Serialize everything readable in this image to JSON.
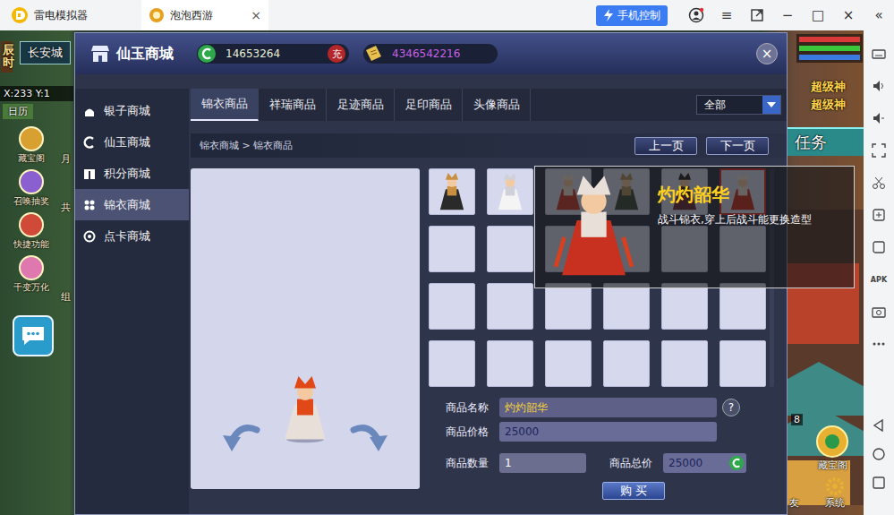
{
  "emulator": {
    "app_name": "雷电模拟器",
    "tab": {
      "label": "泡泡西游",
      "close": "×"
    },
    "phone_control": "手机控制",
    "window_buttons": [
      "≡",
      "−",
      "□",
      "×"
    ],
    "collapse": "«",
    "sidebar_label": "APK"
  },
  "hud": {
    "time": "辰时",
    "map": "长安城",
    "coords": "X:233 Y:1",
    "calendar": "日历",
    "left_buttons": [
      {
        "label": "藏宝阁"
      },
      {
        "label": "召唤抽奖"
      },
      {
        "label": "快捷功能"
      },
      {
        "label": "千变万化"
      }
    ],
    "side_labels": [
      "月",
      "共",
      "组"
    ],
    "banners": [
      "超级神",
      "超级神"
    ],
    "task": "任务",
    "badge": "8",
    "treasure": "藏宝阁",
    "friend": "友",
    "system": "系统"
  },
  "shop": {
    "title": "仙玉商城",
    "currency1": "14653264",
    "recharge": "充",
    "currency2": "4346542216",
    "close": "×",
    "nav": [
      {
        "label": "银子商城",
        "selected": false
      },
      {
        "label": "仙玉商城",
        "selected": false
      },
      {
        "label": "积分商城",
        "selected": false
      },
      {
        "label": "锦衣商城",
        "selected": true
      },
      {
        "label": "点卡商城",
        "selected": false
      }
    ],
    "tabs": [
      {
        "label": "锦衣商品",
        "selected": true
      },
      {
        "label": "祥瑞商品",
        "selected": false
      },
      {
        "label": "足迹商品",
        "selected": false
      },
      {
        "label": "足印商品",
        "selected": false
      },
      {
        "label": "头像商品",
        "selected": false
      }
    ],
    "filter": "全部",
    "breadcrumb": "锦衣商城 > 锦衣商品",
    "prev": "上一页",
    "next": "下一页",
    "items": [
      {
        "filled": true,
        "selected": false
      },
      {
        "filled": true,
        "selected": false
      },
      {
        "filled": true,
        "selected": false
      },
      {
        "filled": true,
        "selected": false
      },
      {
        "filled": true,
        "selected": false
      },
      {
        "filled": true,
        "selected": true
      },
      {
        "filled": false,
        "selected": false
      },
      {
        "filled": false,
        "selected": false
      },
      {
        "filled": false,
        "selected": false
      },
      {
        "filled": false,
        "selected": false
      },
      {
        "filled": false,
        "selected": false
      },
      {
        "filled": false,
        "selected": false
      },
      {
        "filled": false,
        "selected": false
      },
      {
        "filled": false,
        "selected": false
      },
      {
        "filled": false,
        "selected": false
      },
      {
        "filled": false,
        "selected": false
      },
      {
        "filled": false,
        "selected": false
      },
      {
        "filled": false,
        "selected": false
      },
      {
        "filled": false,
        "selected": false
      },
      {
        "filled": false,
        "selected": false
      },
      {
        "filled": false,
        "selected": false
      },
      {
        "filled": false,
        "selected": false
      },
      {
        "filled": false,
        "selected": false
      },
      {
        "filled": false,
        "selected": false
      }
    ],
    "tooltip": {
      "name": "灼灼韶华",
      "description": "战斗锦衣,穿上后战斗能更换造型"
    },
    "form": {
      "name_label": "商品名称",
      "name": "灼灼韶华",
      "price_label": "商品价格",
      "price": "25000",
      "qty_label": "商品数量",
      "qty": "1",
      "total_label": "商品总价",
      "total": "25000",
      "help": "?"
    },
    "buy": "购 买"
  }
}
